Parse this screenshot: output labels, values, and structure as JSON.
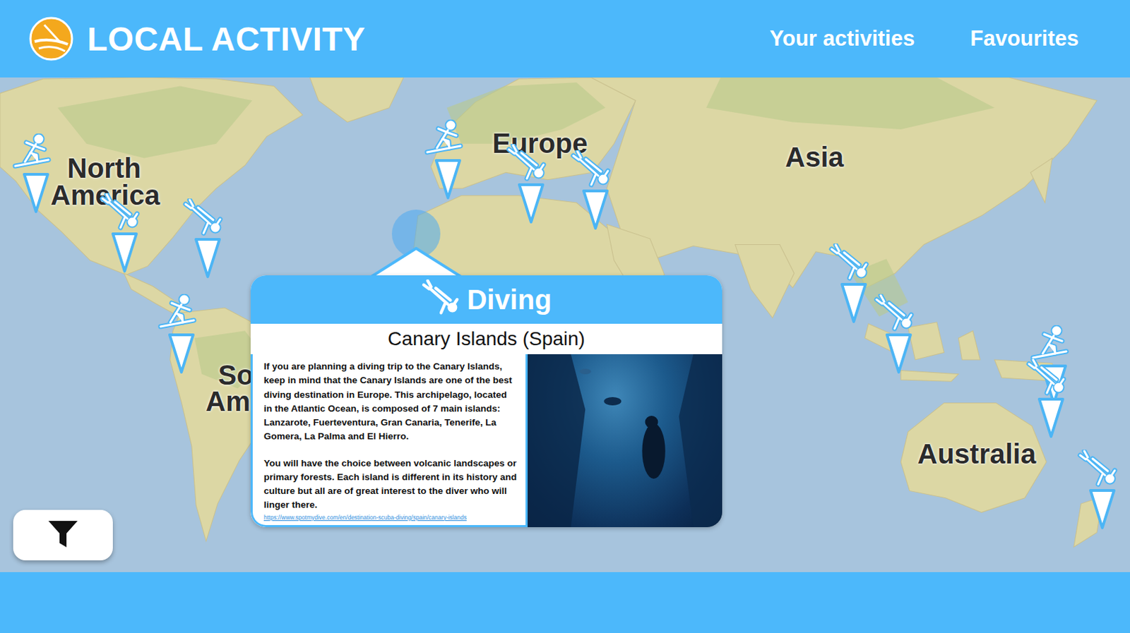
{
  "header": {
    "title": "LOCAL ACTIVITY",
    "nav": [
      {
        "label": "Your activities"
      },
      {
        "label": "Favourites"
      }
    ]
  },
  "map": {
    "labels": [
      {
        "lines": [
          "North",
          "America"
        ]
      },
      {
        "lines": [
          "Europe"
        ]
      },
      {
        "lines": [
          "Asia"
        ]
      },
      {
        "lines": [
          "Australia"
        ]
      },
      {
        "lines": [
          "So",
          "Am"
        ]
      }
    ],
    "pins": [
      {
        "kind": "surfing",
        "selected": false
      },
      {
        "kind": "diving",
        "selected": false
      },
      {
        "kind": "diving",
        "selected": false
      },
      {
        "kind": "surfing",
        "selected": false
      },
      {
        "kind": "surfing",
        "selected": false
      },
      {
        "kind": "diving",
        "selected": false
      },
      {
        "kind": "diving",
        "selected": false
      },
      {
        "kind": "diving",
        "selected": false
      },
      {
        "kind": "diving",
        "selected": false
      },
      {
        "kind": "surfing",
        "selected": false
      },
      {
        "kind": "diving",
        "selected": false
      },
      {
        "kind": "diving",
        "selected": false
      },
      {
        "kind": "diving",
        "selected": true
      }
    ]
  },
  "popup": {
    "activity": "Diving",
    "place": "Canary Islands (Spain)",
    "paragraphs": [
      "If you are planning a diving trip to the Canary Islands, keep in mind that the Canary Islands are one of the best diving destination in Europe. This archipelago, located in the Atlantic Ocean, is composed of 7 main islands: Lanzarote, Fuerteventura, Gran Canaria, Tenerife, La Gomera, La Palma and El Hierro.",
      "You will have the choice between volcanic landscapes or primary forests. Each island is different in its history and culture but all are of great interest to the diver who will linger there."
    ],
    "link": "https://www.spotmydive.com/en/destination-scuba-diving/spain/canary-islands"
  }
}
